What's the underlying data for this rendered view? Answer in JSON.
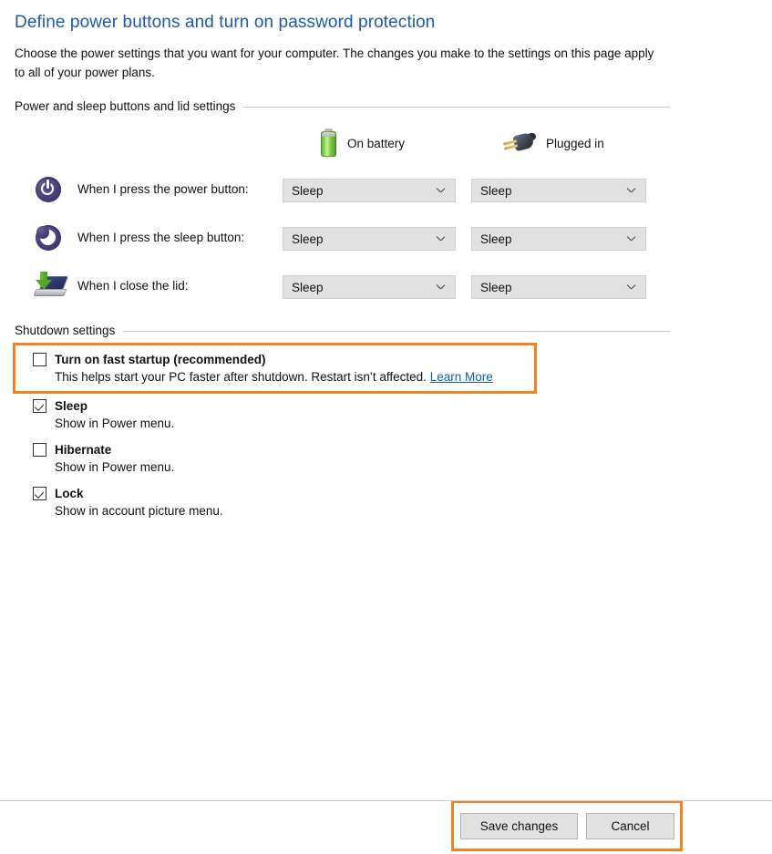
{
  "page": {
    "title": "Define power buttons and turn on password protection",
    "description": "Choose the power settings that you want for your computer. The changes you make to the settings on this page apply to all of your power plans."
  },
  "colors": {
    "title_blue": "#1f5aa6",
    "link_blue": "#0b5fb8",
    "highlight_orange": "#f58220",
    "control_gray": "#e1e1e1",
    "rule_gray": "#c8c8c8"
  },
  "sections": {
    "power_and_sleep": {
      "header": "Power and sleep buttons and lid settings",
      "columns": [
        {
          "icon": "battery-icon",
          "label": "On battery"
        },
        {
          "icon": "plug-icon",
          "label": "Plugged in"
        }
      ],
      "rows": [
        {
          "icon": "power-button-icon",
          "label": "When I press the power button:",
          "on_battery": "Sleep",
          "plugged_in": "Sleep"
        },
        {
          "icon": "sleep-button-icon",
          "label": "When I press the sleep button:",
          "on_battery": "Sleep",
          "plugged_in": "Sleep"
        },
        {
          "icon": "close-lid-icon",
          "label": "When I close the lid:",
          "on_battery": "Sleep",
          "plugged_in": "Sleep"
        }
      ]
    },
    "shutdown_settings": {
      "header": "Shutdown settings",
      "options": [
        {
          "title": "Turn on fast startup (recommended)",
          "checked": false,
          "description": "This helps start your PC faster after shutdown. Restart isn’t affected.",
          "link_text": "Learn More",
          "highlighted": true
        },
        {
          "title": "Sleep",
          "checked": true,
          "description": "Show in Power menu.",
          "link_text": "",
          "highlighted": false
        },
        {
          "title": "Hibernate",
          "checked": false,
          "description": "Show in Power menu.",
          "link_text": "",
          "highlighted": false
        },
        {
          "title": "Lock",
          "checked": true,
          "description": "Show in account picture menu.",
          "link_text": "",
          "highlighted": false
        }
      ]
    }
  },
  "footer": {
    "save_label": "Save changes",
    "cancel_label": "Cancel",
    "highlighted": true
  }
}
